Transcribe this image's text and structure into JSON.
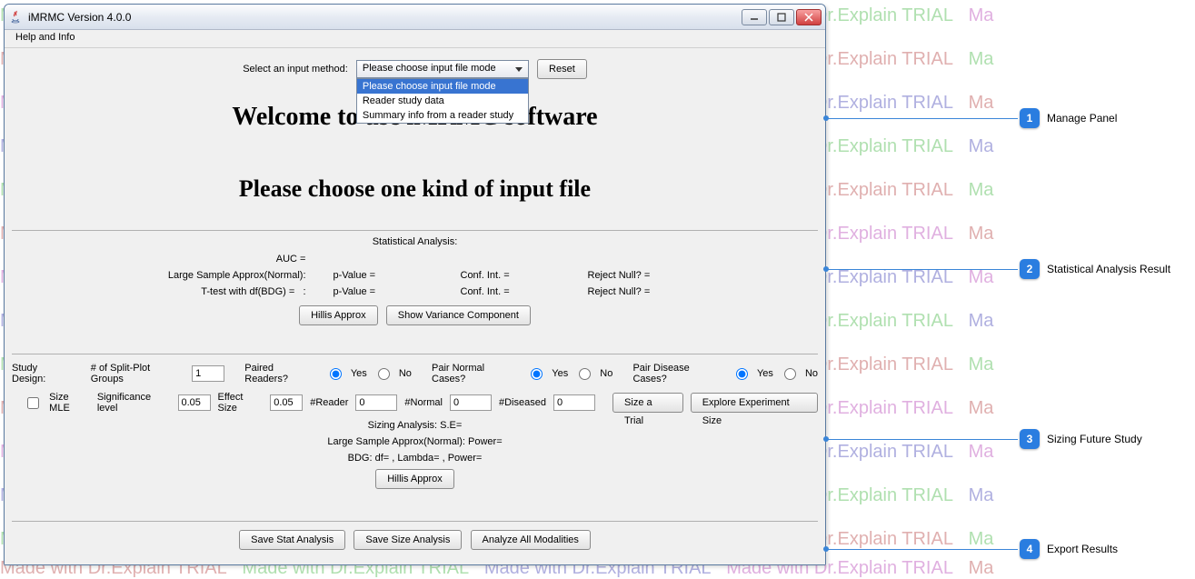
{
  "watermark_text": "Made with Dr.Explain TRIAL",
  "window": {
    "title": "iMRMC Version 4.0.0",
    "menu": {
      "help": "Help and Info"
    },
    "input_method_label": "Select an input method:",
    "dropdown": {
      "selected": "Please choose input file mode",
      "options": [
        "Please choose input file mode",
        "Reader study data",
        "Summary info from a reader study"
      ]
    },
    "reset_btn": "Reset",
    "welcome": "Welcome to use iMRMC software",
    "choose_prompt": "Please choose one kind of input file"
  },
  "stat": {
    "title": "Statistical Analysis:",
    "auc": "AUC =",
    "lsa_label": "Large Sample Approx(Normal):",
    "pvalue_label": "p-Value =",
    "confint_label": "Conf. Int. =",
    "rejectnull_label": "Reject Null? =",
    "ttest_label": "T-test with df(BDG) =",
    "ttest_sep": ":",
    "hillis_btn": "Hillis Approx",
    "variance_btn": "Show Variance Component"
  },
  "study": {
    "design_label": "Study Design:",
    "split_label": "# of Split-Plot Groups",
    "split_value": "1",
    "paired_readers": "Paired Readers?",
    "yes": "Yes",
    "no": "No",
    "pair_normal": "Pair Normal Cases?",
    "pair_disease": "Pair Disease Cases?",
    "size_mle": "Size MLE",
    "sig_level_label": "Significance level",
    "sig_level_value": "0.05",
    "effect_size_label": "Effect Size",
    "effect_size_value": "0.05",
    "num_reader_label": "#Reader",
    "num_reader_value": "0",
    "num_normal_label": "#Normal",
    "num_normal_value": "0",
    "num_diseased_label": "#Diseased",
    "num_diseased_value": "0",
    "size_trial_btn": "Size a Trial",
    "explore_btn": "Explore Experiment Size",
    "sizing_analysis": "Sizing Analysis:   S.E=",
    "lsa_power": "Large Sample Approx(Normal):   Power=",
    "bdg_line": "BDG:   df=   ,  Lambda=   ,  Power=",
    "hillis_btn": "Hillis Approx"
  },
  "export": {
    "save_stat": "Save Stat Analysis",
    "save_size": "Save Size Analysis",
    "analyze_all": "Analyze All Modalities"
  },
  "callouts": [
    {
      "num": "1",
      "label": "Manage Panel"
    },
    {
      "num": "2",
      "label": "Statistical Analysis Result"
    },
    {
      "num": "3",
      "label": "Sizing Future Study"
    },
    {
      "num": "4",
      "label": "Export Results"
    }
  ]
}
